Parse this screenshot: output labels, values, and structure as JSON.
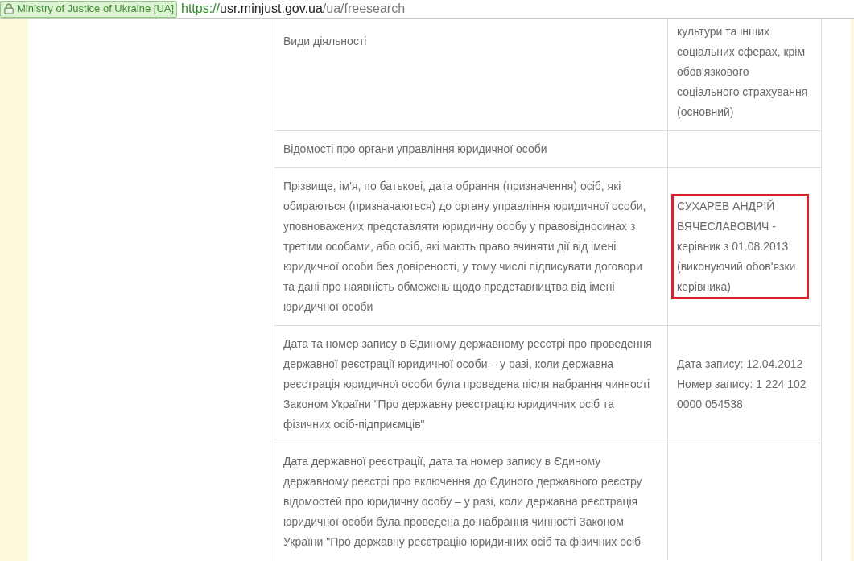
{
  "browser": {
    "site_identity": "Ministry of Justice of Ukraine [UA]",
    "url": {
      "scheme": "https://",
      "host": "usr.minjust.gov.ua",
      "path": "/ua/freesearch"
    }
  },
  "table": {
    "rows": [
      {
        "label": "Види діяльності",
        "value": [
          "культури та інших соціальних сферах, крім обов'язкового соціального страхування (основний)"
        ],
        "highlighted": false
      },
      {
        "label": "Відомості про органи управління юридичної особи"
      },
      {
        "label": "Прізвище, ім'я, по батькові, дата обрання (призначення) осіб, які обираються (призначаються) до органу управління юридичної особи, уповноважених представляти юридичну особу у правовідносинах з третіми особами, або осіб, які мають право вчиняти дії від імені юридичної особи без довіреності, у тому числі підписувати договори та дані про наявність обмежень щодо представництва від імені юридичної особи",
        "value": [
          "СУХАРЕВ АНДРІЙ ВЯЧЕСЛАВОВИЧ - керівник з 01.08.2013 (виконуючий обов'язки керівника)"
        ],
        "highlighted": true
      },
      {
        "label": "Дата та номер запису в Єдиному державному реєстрі про проведення державної реєстрації юридичної особи – у разі, коли державна реєстрація юридичної особи була проведена після набрання чинності Законом України \"Про державну реєстрацію юридичних осіб та фізичних осіб-підприємців\"",
        "value": [
          "Дата запису: 12.04.2012",
          "Номер запису: 1 224 102 0000 054538"
        ],
        "highlighted": false
      },
      {
        "label": "Дата державної реєстрації, дата та номер запису в Єдиному державному реєстрі про включення до Єдиного державного реєстру відомостей про юридичну особу – у разі, коли державна реєстрація юридичної особи була проведена до набрання чинності Законом України \"Про державну реєстрацію юридичних осіб та фізичних осіб-"
      }
    ]
  }
}
